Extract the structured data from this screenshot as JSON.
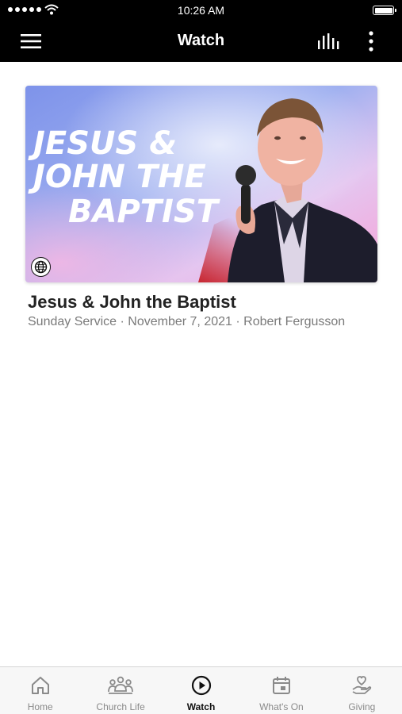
{
  "status_bar": {
    "time": "10:26 AM"
  },
  "nav": {
    "title": "Watch"
  },
  "card": {
    "artwork_text": [
      "JESUS &",
      "JOHN THE",
      "BAPTIST"
    ],
    "colors": {
      "sky": "#7f8fe6",
      "pink": "#f7a6d8",
      "red": "#c4151c"
    }
  },
  "video": {
    "title": "Jesus & John the Baptist",
    "meta": "Sunday Service · November 7, 2021 · Robert Fergusson"
  },
  "tabs": [
    {
      "label": "Home",
      "icon": "home-icon"
    },
    {
      "label": "Church Life",
      "icon": "people-icon"
    },
    {
      "label": "Watch",
      "icon": "play-circle-icon",
      "active": true
    },
    {
      "label": "What's On",
      "icon": "calendar-icon"
    },
    {
      "label": "Giving",
      "icon": "hand-heart-icon"
    }
  ]
}
